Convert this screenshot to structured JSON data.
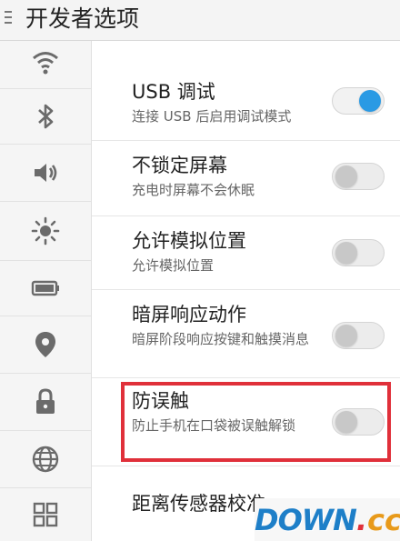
{
  "header": {
    "title": "开发者选项"
  },
  "sidebar": {
    "items": [
      {
        "icon": "wifi-icon"
      },
      {
        "icon": "bluetooth-icon"
      },
      {
        "icon": "volume-icon"
      },
      {
        "icon": "brightness-icon"
      },
      {
        "icon": "battery-icon"
      },
      {
        "icon": "location-icon"
      },
      {
        "icon": "lock-icon"
      },
      {
        "icon": "globe-icon"
      },
      {
        "icon": "apps-grid-icon"
      }
    ]
  },
  "settings": [
    {
      "title": "USB 调试",
      "subtitle": "连接 USB 后启用调试模式",
      "enabled": true
    },
    {
      "title": "不锁定屏幕",
      "subtitle": "充电时屏幕不会休眠",
      "enabled": false
    },
    {
      "title": "允许模拟位置",
      "subtitle": "允许模拟位置",
      "enabled": false
    },
    {
      "title": "暗屏响应动作",
      "subtitle": "暗屏阶段响应按键和触摸消息",
      "enabled": false
    },
    {
      "title": "防误触",
      "subtitle": "防止手机在口袋被误触解锁",
      "enabled": false
    },
    {
      "title": "距离传感器校准",
      "subtitle": "",
      "enabled": null
    }
  ],
  "colors": {
    "accent": "#2a9ae4",
    "highlight": "#e0303a"
  },
  "watermark": {
    "text_main": "DOWN",
    "text_dot": ".",
    "text_cc": "cc"
  }
}
